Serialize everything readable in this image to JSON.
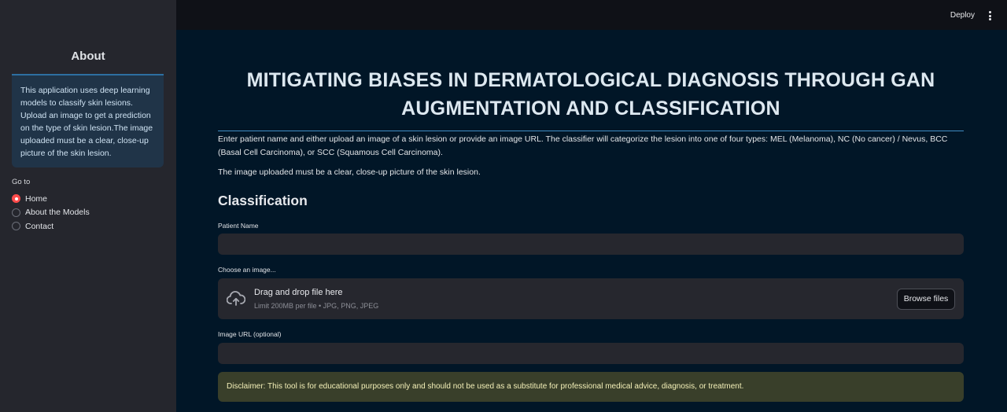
{
  "sidebar": {
    "title": "About",
    "about_text": "This application uses deep learning models to classify skin lesions. Upload an image to get a prediction on the type of skin lesion.The image uploaded must be a clear, close-up picture of the skin lesion.",
    "goto_label": "Go to",
    "nav_items": [
      {
        "label": "Home",
        "selected": true
      },
      {
        "label": "About the Models",
        "selected": false
      },
      {
        "label": "Contact",
        "selected": false
      }
    ]
  },
  "header": {
    "deploy_label": "Deploy",
    "menu_icon": "vertical-ellipsis-icon"
  },
  "main": {
    "title": "MITIGATING BIASES IN DERMATOLOGICAL DIAGNOSIS THROUGH GAN AUGMENTATION AND CLASSIFICATION",
    "intro": "Enter patient name and either upload an image of a skin lesion or provide an image URL. The classifier will categorize the lesion into one of four types: MEL (Melanoma), NC (No cancer) / Nevus, BCC (Basal Cell Carcinoma), or SCC (Squamous Cell Carcinoma).",
    "note": "The image uploaded must be a clear, close-up picture of the skin lesion.",
    "section_heading": "Classification",
    "patient_label": "Patient Name",
    "patient_value": "",
    "image_label": "Choose an image...",
    "uploader": {
      "icon": "cloud-upload-icon",
      "title": "Drag and drop file here",
      "hint": "Limit 200MB per file • JPG, PNG, JPEG",
      "browse_label": "Browse files"
    },
    "url_label": "Image URL (optional)",
    "url_value": "",
    "disclaimer": "Disclaimer: This tool is for educational purposes only and should not be used as a substitute for professional medical advice, diagnosis, or treatment."
  },
  "colors": {
    "accent": "#ff4b4b",
    "divider": "#3f8cc2",
    "disclaimer_bg": "#393f2a"
  }
}
